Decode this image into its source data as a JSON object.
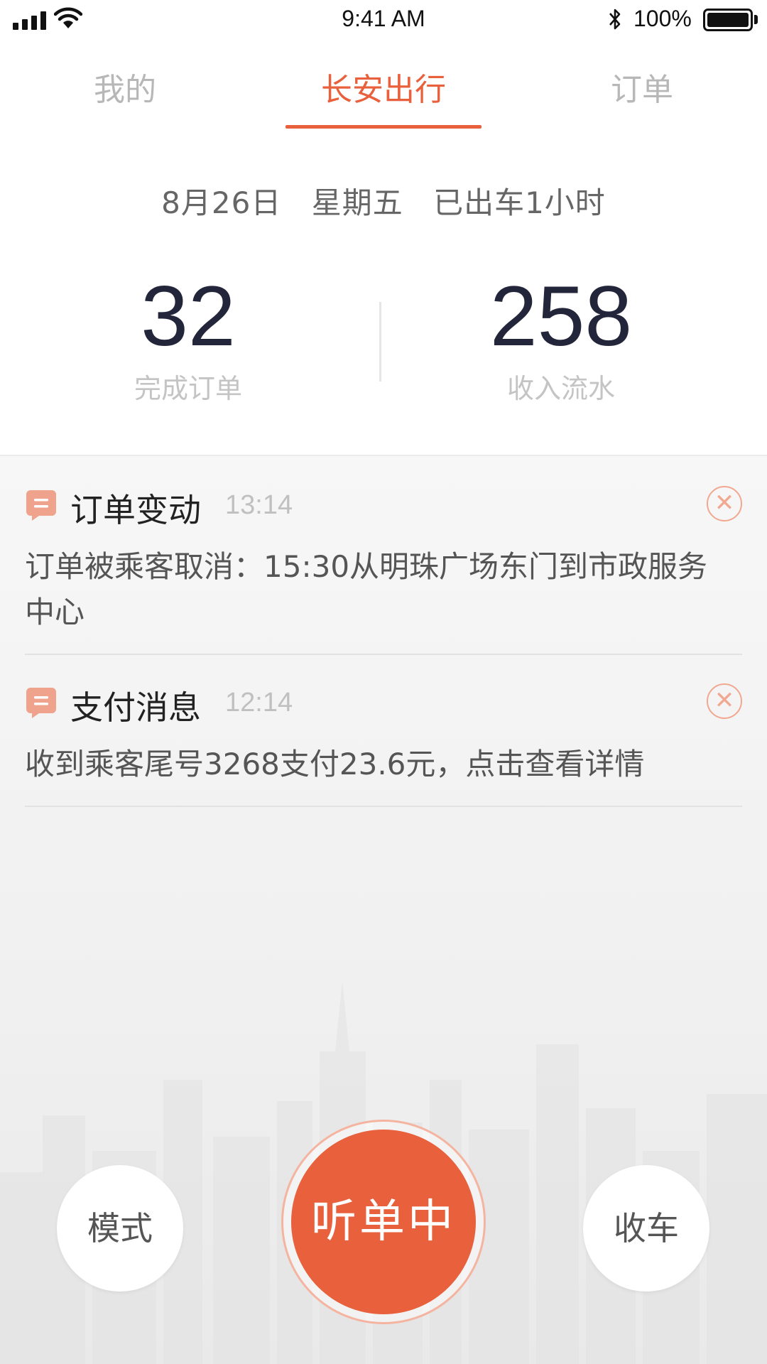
{
  "status_bar": {
    "time": "9:41 AM",
    "battery_text": "100%",
    "battery_level": 1.0,
    "icons": [
      "signal-icon",
      "wifi-icon",
      "bluetooth-icon",
      "battery-icon"
    ]
  },
  "tabs": [
    {
      "label": "我的",
      "active": false
    },
    {
      "label": "长安出行",
      "active": true
    },
    {
      "label": "订单",
      "active": false
    }
  ],
  "date_info": {
    "date": "8月26日",
    "weekday": "星期五",
    "duration": "已出车1小时"
  },
  "stats": {
    "orders": {
      "value": "32",
      "label": "完成订单"
    },
    "income": {
      "value": "258",
      "label": "收入流水"
    }
  },
  "notices": [
    {
      "title": "订单变动",
      "time": "13:14",
      "body": "订单被乘客取消：15:30从明珠广场东门到市政服务中心",
      "icon": "message-icon"
    },
    {
      "title": "支付消息",
      "time": "12:14",
      "body": "收到乘客尾号3268支付23.6元，点击查看详情",
      "icon": "message-icon"
    }
  ],
  "buttons": {
    "mode": "模式",
    "listen": "听单中",
    "finish": "收车",
    "close_glyph": "✕"
  },
  "colors": {
    "accent": "#e8603c",
    "icon_accent": "#f0a38c",
    "number": "#23253a"
  }
}
